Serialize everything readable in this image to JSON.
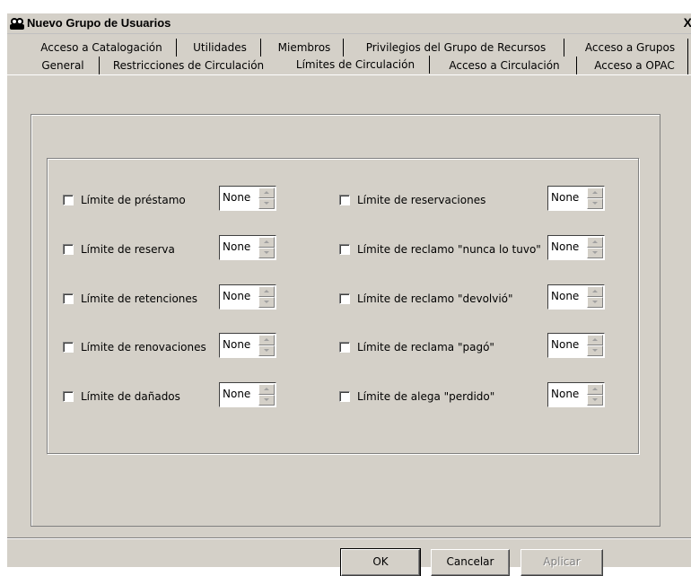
{
  "window": {
    "title": "Nuevo Grupo de Usuarios",
    "close_label": "X"
  },
  "tabs_row1": [
    "Acceso a Catalogación",
    "Utilidades",
    "Miembros",
    "Privilegios del Grupo de Recursos",
    "Acceso a Grupos"
  ],
  "tabs_row2": [
    "General",
    "Restricciones de Circulación",
    "Límites de Circulación",
    "Acceso a Circulación",
    "Acceso a OPAC"
  ],
  "active_tab": "Límites de Circulación",
  "limits_left": [
    {
      "label": "Límite de préstamo",
      "value": "None",
      "checked": false
    },
    {
      "label": "Límite de reserva",
      "value": "None",
      "checked": false
    },
    {
      "label": "Límite de retenciones",
      "value": "None",
      "checked": false
    },
    {
      "label": "Límite de renovaciones",
      "value": "None",
      "checked": false
    },
    {
      "label": "Límite de dañados",
      "value": "None",
      "checked": false
    }
  ],
  "limits_right": [
    {
      "label": "Límite de reservaciones",
      "value": "None",
      "checked": false
    },
    {
      "label": "Límite de reclamo \"nunca lo tuvo\"",
      "value": "None",
      "checked": false
    },
    {
      "label": "Límite de reclamo \"devolvió\"",
      "value": "None",
      "checked": false
    },
    {
      "label": "Límite de reclama \"pagó\"",
      "value": "None",
      "checked": false
    },
    {
      "label": "Límite de alega \"perdido\"",
      "value": "None",
      "checked": false
    }
  ],
  "buttons": {
    "ok": "OK",
    "cancel": "Cancelar",
    "apply": "Aplicar"
  },
  "colors": {
    "face": "#d4d0c8",
    "shadow": "#808080",
    "highlight": "#ffffff"
  }
}
